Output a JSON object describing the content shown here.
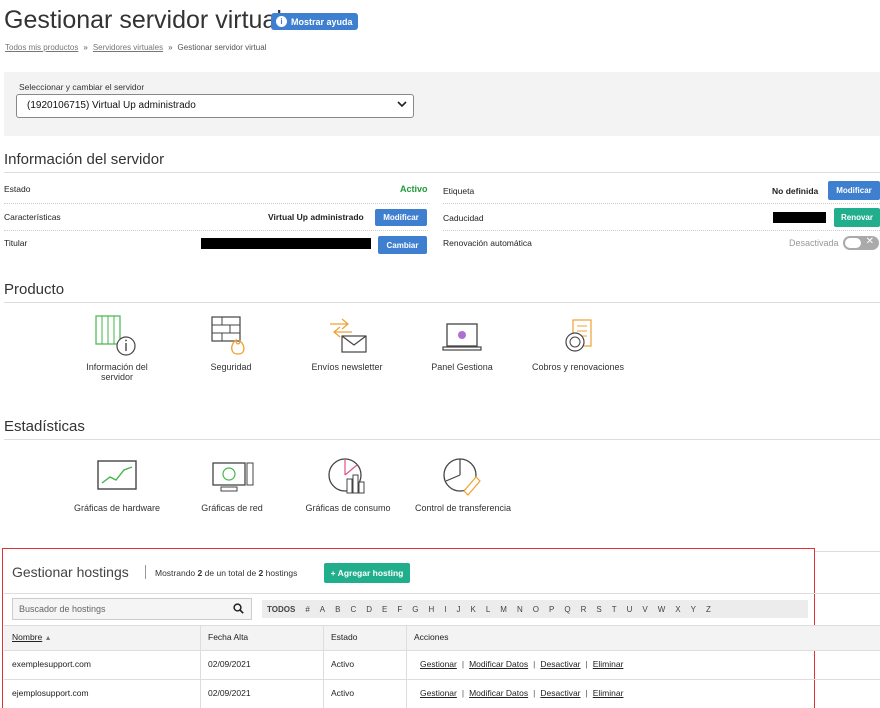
{
  "header": {
    "title": "Gestionar servidor virtual",
    "help_label": "Mostrar ayuda"
  },
  "breadcrumb": {
    "items": [
      "Todos mis productos",
      "Servidores virtuales",
      "Gestionar servidor virtual"
    ],
    "separator": "»"
  },
  "server_select": {
    "label": "Seleccionar y cambiar el servidor",
    "value": "(1920106715) Virtual Up administrado"
  },
  "info": {
    "title": "Información del servidor",
    "left": {
      "estado_label": "Estado",
      "estado_value": "Activo",
      "caracteristicas_label": "Características",
      "caracteristicas_value": "Virtual Up administrado",
      "caracteristicas_button": "Modificar",
      "titular_label": "Titular",
      "titular_button": "Cambiar"
    },
    "right": {
      "etiqueta_label": "Etiqueta",
      "etiqueta_value": "No definida",
      "etiqueta_button": "Modificar",
      "caducidad_label": "Caducidad",
      "caducidad_button": "Renovar",
      "renovacion_label": "Renovación automática",
      "renovacion_value": "Desactivada"
    }
  },
  "producto": {
    "title": "Producto",
    "tiles": [
      "Información del servidor",
      "Seguridad",
      "Envíos newsletter",
      "Panel Gestiona",
      "Cobros y renovaciones"
    ]
  },
  "estadisticas": {
    "title": "Estadísticas",
    "tiles": [
      "Gráficas de hardware",
      "Gráficas de red",
      "Gráficas de consumo",
      "Control de transferencia"
    ]
  },
  "hostings": {
    "title": "Gestionar hostings",
    "count_prefix": "Mostrando",
    "count_shown": "2",
    "count_mid": "de un total de",
    "count_total": "2",
    "count_suffix": "hostings",
    "add_button": "+ Agregar hosting",
    "search_placeholder": "Buscador de hostings",
    "filter_all": "TODOS",
    "letters": [
      "#",
      "A",
      "B",
      "C",
      "D",
      "E",
      "F",
      "G",
      "H",
      "I",
      "J",
      "K",
      "L",
      "M",
      "N",
      "O",
      "P",
      "Q",
      "R",
      "S",
      "T",
      "U",
      "V",
      "W",
      "X",
      "Y",
      "Z"
    ],
    "columns": [
      "Nombre",
      "Fecha Alta",
      "Estado",
      "Acciones"
    ],
    "rows": [
      {
        "name": "exemplesupport.com",
        "date": "02/09/2021",
        "status": "Activo"
      },
      {
        "name": "ejemplosupport.com",
        "date": "02/09/2021",
        "status": "Activo"
      }
    ],
    "actions": [
      "Gestionar",
      "Modificar Datos",
      "Desactivar",
      "Eliminar"
    ]
  },
  "colors": {
    "accent_blue": "#3f7fcf",
    "accent_green": "#21ae8c",
    "status_green": "#1f9b3a",
    "highlight_red": "#d33333"
  }
}
